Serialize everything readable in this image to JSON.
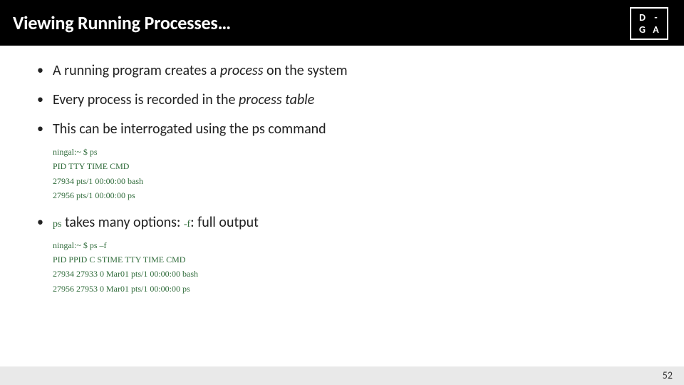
{
  "header": {
    "title": "Viewing Running Processes…"
  },
  "logo": {
    "tl": "D",
    "tr": "-",
    "bl": "G",
    "br": "A"
  },
  "bullets": {
    "b1_pre": "A running program creates a ",
    "b1_em": "process",
    "b1_post": " on the system",
    "b2_pre": "Every process is recorded in the ",
    "b2_em": "process table",
    "b3": "This can be interrogated using the ps command",
    "b4_code": "ps",
    "b4_mid": " takes many options: ",
    "b4_flag": "-f",
    "b4_post": ": full output"
  },
  "term1": {
    "l1": "ningal:~ $ ps",
    "l2": "PID TTY TIME CMD",
    "l3": "27934 pts/1 00:00:00 bash",
    "l4": "27956 pts/1 00:00:00 ps"
  },
  "term2": {
    "l1": "ningal:~ $ ps –f",
    "l2": "PID PPID C STIME TTY TIME CMD",
    "l3": "27934 27933 0 Mar01 pts/1 00:00:00 bash",
    "l4": "27956 27953 0 Mar01 pts/1 00:00:00 ps"
  },
  "page": "52"
}
